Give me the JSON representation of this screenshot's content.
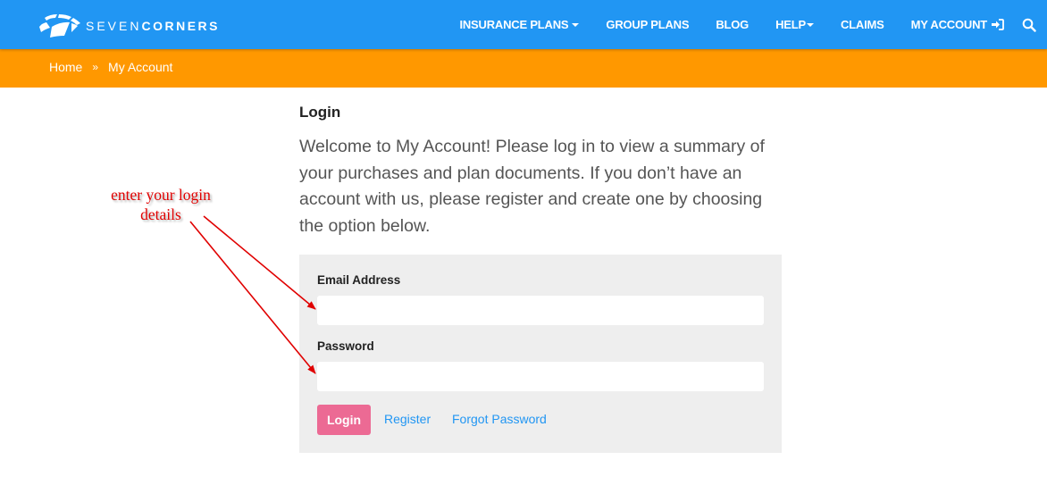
{
  "brand": {
    "name_light": "SEVEN",
    "name_bold": "CORNERS"
  },
  "nav": {
    "items": [
      {
        "label": "INSURANCE PLANS",
        "dropdown": true
      },
      {
        "label": "GROUP PLANS",
        "dropdown": false
      },
      {
        "label": "BLOG",
        "dropdown": false
      },
      {
        "label": "HELP",
        "dropdown": true
      },
      {
        "label": "CLAIMS",
        "dropdown": false
      },
      {
        "label": "MY ACCOUNT",
        "icon": "sign-in-icon"
      }
    ],
    "search_icon": "search-icon"
  },
  "breadcrumb": {
    "items": [
      "Home",
      "My Account"
    ],
    "separator": "»"
  },
  "main": {
    "heading": "Login",
    "intro": "Welcome to My Account! Please log in to view a summary of your purchases and plan documents. If you don’t have an account with us, please register and create one by choosing the option below."
  },
  "form": {
    "email_label": "Email Address",
    "email_value": "",
    "password_label": "Password",
    "password_value": "",
    "login_button": "Login",
    "register_link": "Register",
    "forgot_link": "Forgot Password"
  },
  "annotation": {
    "line1": "enter your login",
    "line2": "details"
  },
  "colors": {
    "nav_bg": "#2196F3",
    "breadcrumb_bg": "#FF9800",
    "login_button": "#EC6A94",
    "link": "#2196F3",
    "annotation": "#E00000"
  }
}
